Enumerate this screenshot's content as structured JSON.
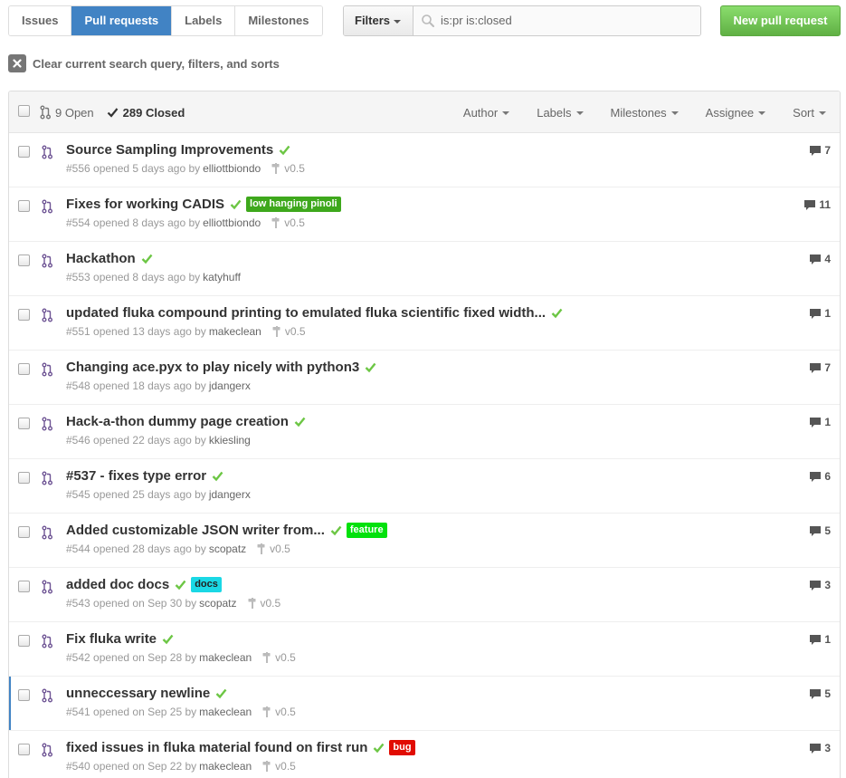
{
  "subnav": [
    {
      "label": "Issues",
      "selected": false
    },
    {
      "label": "Pull requests",
      "selected": true
    },
    {
      "label": "Labels",
      "selected": false
    },
    {
      "label": "Milestones",
      "selected": false
    }
  ],
  "filters": {
    "label": "Filters",
    "query": "is:pr is:closed"
  },
  "new_pr_label": "New pull request",
  "clear_label": "Clear current search query, filters, and sorts",
  "header": {
    "open": "9 Open",
    "closed": "289 Closed",
    "filters": [
      "Author",
      "Labels",
      "Milestones",
      "Assignee",
      "Sort"
    ]
  },
  "colors": {
    "accent": "#4183c4",
    "green": "#6cc644",
    "pr_icon": "#6e5494"
  },
  "rows": [
    {
      "title": "Source Sampling Improvements",
      "meta": "#556 opened 5 days ago by",
      "author": "elliottbiondo",
      "milestone": "v0.5",
      "comments": "7",
      "labels": []
    },
    {
      "title": "Fixes for working CADIS",
      "meta": "#554 opened 8 days ago by",
      "author": "elliottbiondo",
      "milestone": "v0.5",
      "comments": "11",
      "labels": [
        {
          "name": "low hanging pinoli",
          "bg": "#3ea81c",
          "fg": "#ffffff"
        }
      ]
    },
    {
      "title": "Hackathon",
      "meta": "#553 opened 8 days ago by",
      "author": "katyhuff",
      "milestone": "",
      "comments": "4",
      "labels": []
    },
    {
      "title": "updated fluka compound printing to emulated fluka scientific fixed width...",
      "meta": "#551 opened 13 days ago by",
      "author": "makeclean",
      "milestone": "v0.5",
      "comments": "1",
      "labels": []
    },
    {
      "title": "Changing ace.pyx to play nicely with python3",
      "meta": "#548 opened 18 days ago by",
      "author": "jdangerx",
      "milestone": "",
      "comments": "7",
      "labels": []
    },
    {
      "title": "Hack-a-thon dummy page creation",
      "meta": "#546 opened 22 days ago by",
      "author": "kkiesling",
      "milestone": "",
      "comments": "1",
      "labels": []
    },
    {
      "title": "#537 - fixes type error",
      "meta": "#545 opened 25 days ago by",
      "author": "jdangerx",
      "milestone": "",
      "comments": "6",
      "labels": []
    },
    {
      "title": "Added customizable JSON writer from...",
      "meta": "#544 opened 28 days ago by",
      "author": "scopatz",
      "milestone": "v0.5",
      "comments": "5",
      "labels": [
        {
          "name": "feature",
          "bg": "#02e10c",
          "fg": "#ffffff"
        }
      ]
    },
    {
      "title": "added doc docs",
      "meta": "#543 opened on Sep 30 by",
      "author": "scopatz",
      "milestone": "v0.5",
      "comments": "3",
      "labels": [
        {
          "name": "docs",
          "bg": "#1ad8e5",
          "fg": "#222222"
        }
      ]
    },
    {
      "title": "Fix fluka write",
      "meta": "#542 opened on Sep 28 by",
      "author": "makeclean",
      "milestone": "v0.5",
      "comments": "1",
      "labels": []
    },
    {
      "title": "unneccessary newline",
      "meta": "#541 opened on Sep 25 by",
      "author": "makeclean",
      "milestone": "v0.5",
      "comments": "5",
      "labels": [],
      "active": true
    },
    {
      "title": "fixed issues in fluka material found on first run",
      "meta": "#540 opened on Sep 22 by",
      "author": "makeclean",
      "milestone": "v0.5",
      "comments": "3",
      "labels": [
        {
          "name": "bug",
          "bg": "#e10c02",
          "fg": "#ffffff"
        }
      ]
    }
  ]
}
